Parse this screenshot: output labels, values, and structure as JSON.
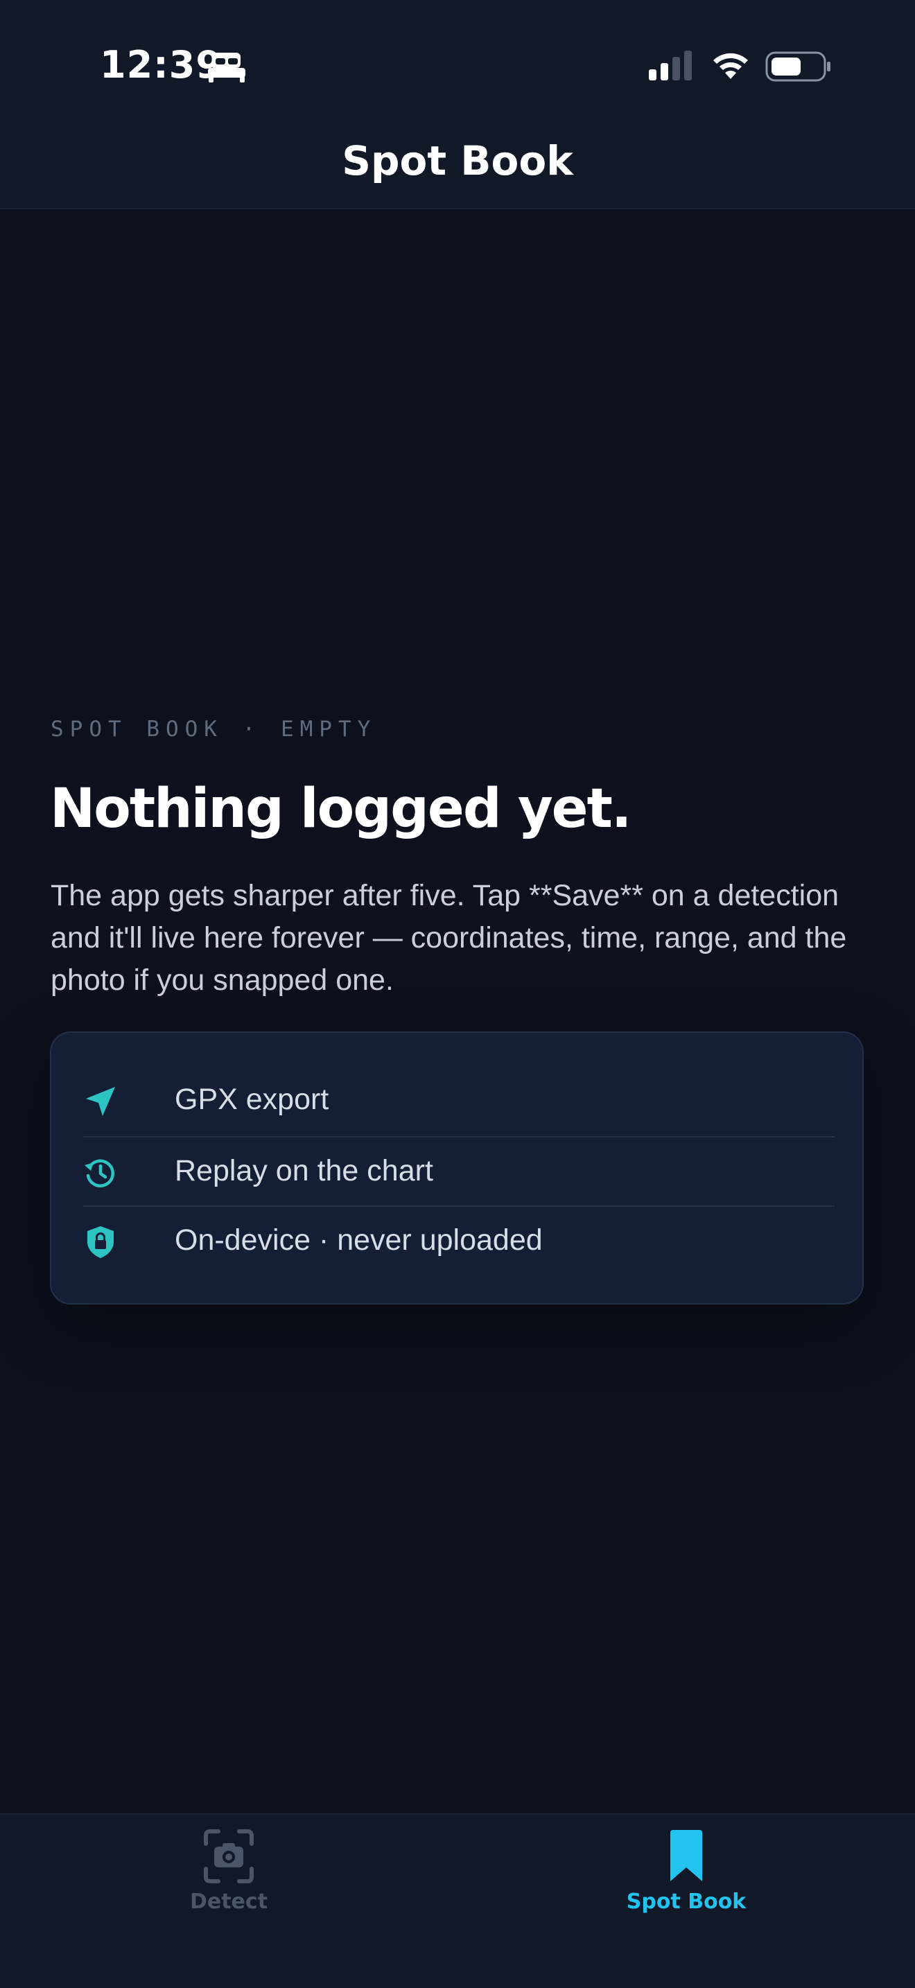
{
  "status_bar": {
    "time": "12:39",
    "icons": [
      "sleep-icon",
      "cellular-signal-icon",
      "wifi-icon",
      "battery-icon"
    ]
  },
  "header": {
    "title": "Spot Book"
  },
  "empty_state": {
    "eyebrow": "SPOT BOOK · EMPTY",
    "headline": "Nothing logged yet.",
    "body": "The app gets sharper after five. Tap **Save** on a detection and it'll live here forever — coordinates, time, range, and the photo if you snapped one.",
    "features": [
      {
        "icon": "navigation-arrow-icon",
        "label": "GPX export"
      },
      {
        "icon": "history-icon",
        "label": "Replay on the chart"
      },
      {
        "icon": "lock-shield-icon",
        "label": "On-device · never uploaded"
      }
    ]
  },
  "tab_bar": {
    "tabs": [
      {
        "icon": "camera-scan-icon",
        "label": "Detect",
        "active": false
      },
      {
        "icon": "bookmark-icon",
        "label": "Spot Book",
        "active": true
      }
    ]
  },
  "colors": {
    "background": "#0c111d",
    "bar_background": "#111827",
    "card_background": "#141e34",
    "accent_teal": "#2ec4c4",
    "accent_cyan": "#22c3ee",
    "inactive": "#4b5567"
  }
}
